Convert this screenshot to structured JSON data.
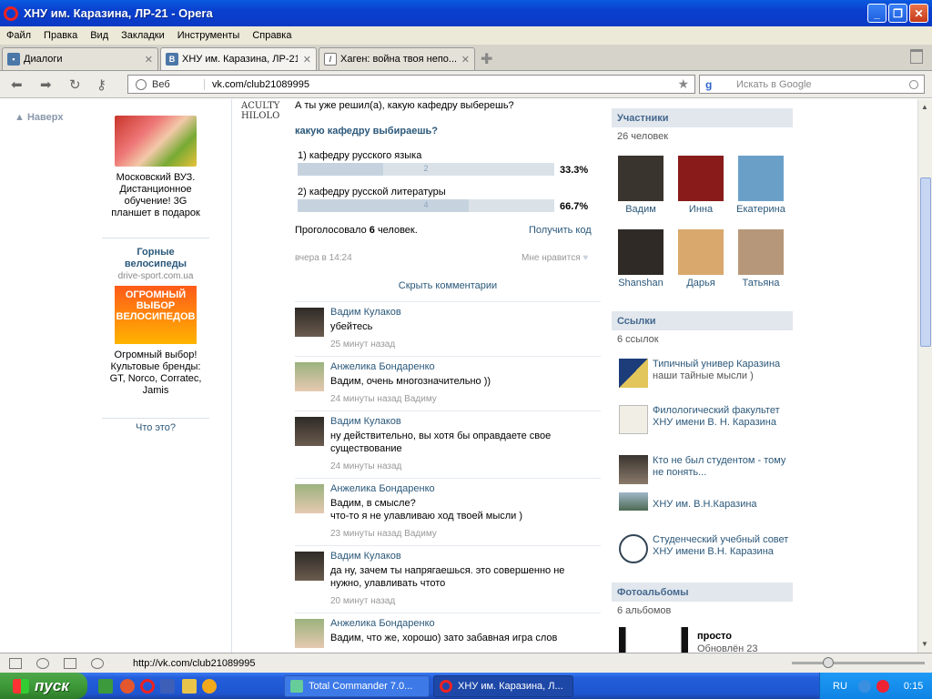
{
  "window": {
    "title": "ХНУ им. Каразина, ЛР-21 - Opera"
  },
  "menu": [
    "Файл",
    "Правка",
    "Вид",
    "Закладки",
    "Инструменты",
    "Справка"
  ],
  "tabs": [
    {
      "label": "Диалоги"
    },
    {
      "label": "ХНУ им. Каразина, ЛР-21"
    },
    {
      "label": "Хаген: война твоя непо..."
    }
  ],
  "address": {
    "scheme_label": "Веб",
    "url": "vk.com/club21089995",
    "search_placeholder": "Искать в Google"
  },
  "left": {
    "back_to_top": "Наверх",
    "ad1": {
      "line1": "Московский ВУЗ.",
      "line2": "Дистанционное",
      "line3": "обучение! 3G",
      "line4": "планшет в подарок"
    },
    "ad2": {
      "title1": "Горные",
      "title2": "велосипеды",
      "domain": "drive-sport.com.ua",
      "banner1": "ОГРОМНЫЙ",
      "banner2": "ВЫБОР",
      "banner3": "ВЕЛОСИПЕДОВ",
      "line1": "Огромный выбор!",
      "line2": "Культовые бренды:",
      "line3": "GT, Norco, Corratec,",
      "line4": "Jamis"
    },
    "what_is": "Что это?"
  },
  "center": {
    "deco1": "ACULTY",
    "deco2": "HILOLO",
    "poll_question": "А ты уже решил(а), какую кафедру выберешь?",
    "poll_title": "какую кафедру выбираешь?",
    "options": [
      {
        "label": "1) кафедру русского языка",
        "count": "2",
        "percent": "33.3%",
        "share": 0.333
      },
      {
        "label": "2) кафедру русской литературы",
        "count": "4",
        "percent": "66.7%",
        "share": 0.667
      }
    ],
    "voted_prefix": "Проголосовало",
    "voted_count": "6",
    "voted_suffix": "человек.",
    "get_code": "Получить код",
    "post_time": "вчера в 14:24",
    "like": "Мне нравится",
    "hide_comments": "Скрыть комментарии",
    "comments": [
      {
        "author": "Вадим Кулаков",
        "text": "убейтесь",
        "time": "25 минут назад"
      },
      {
        "author": "Анжелика Бондаренко",
        "text": "Вадим, очень многозначительно ))",
        "time": "24 минуты назад Вадиму"
      },
      {
        "author": "Вадим Кулаков",
        "text": "ну действительно, вы хотя бы оправдаете свое существование",
        "time": "24 минуты назад"
      },
      {
        "author": "Анжелика Бондаренко",
        "text": "Вадим, в смысле?",
        "text2": "что-то я не улавливаю ход твоей мысли )",
        "time": "23 минуты назад Вадиму"
      },
      {
        "author": "Вадим Кулаков",
        "text": "да ну, зачем ты напрягаешься. это совершенно не нужно, улавливать чтото",
        "time": "20 минут назад"
      },
      {
        "author": "Анжелика Бондаренко",
        "text": "Вадим, что же, хорошо) зато забавная игра слов",
        "time": ""
      }
    ]
  },
  "right": {
    "members_title": "Участники",
    "members_count": "26 человек",
    "members": [
      {
        "name": "Вадим",
        "color": "#3a342e"
      },
      {
        "name": "Инна",
        "color": "#8a1b1b"
      },
      {
        "name": "Екатерина",
        "color": "#6aa0c8"
      },
      {
        "name": "Shanshan",
        "color": "#2f2a26"
      },
      {
        "name": "Дарья",
        "color": "#d9a86c"
      },
      {
        "name": "Татьяна",
        "color": "#b6977a"
      }
    ],
    "links_title": "Ссылки",
    "links_count": "6 ссылок",
    "links": [
      {
        "title": "Типичный универ Каразина",
        "sub": "наши тайные мысли )"
      },
      {
        "title": "Филологический факультет ХНУ имени В. Н. Каразина",
        "sub": ""
      },
      {
        "title": "Кто не был студентом - тому не понять...",
        "sub": ""
      },
      {
        "title": "ХНУ им. В.Н.Каразина",
        "sub": ""
      },
      {
        "title": "Студенческий учебный совет ХНУ имени В.Н. Каразина",
        "sub": ""
      }
    ],
    "albums_title": "Фотоальбомы",
    "albums_count": "6 альбомов",
    "album": {
      "name": "просто",
      "updated": "Обновлён 23"
    }
  },
  "status": {
    "url": "http://vk.com/club21089995"
  },
  "taskbar": {
    "start": "пуск",
    "tasks": [
      "Total Commander 7.0...",
      "ХНУ им. Каразина, Л..."
    ],
    "lang": "RU",
    "clock": "0:15"
  }
}
